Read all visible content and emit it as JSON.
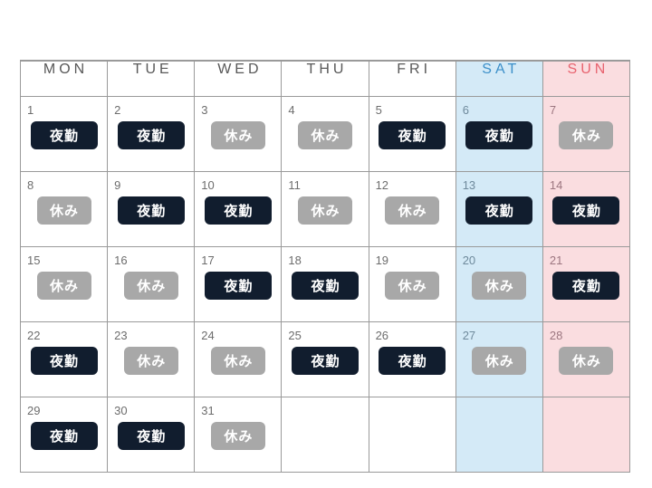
{
  "calendar": {
    "headers": [
      {
        "label": "MON",
        "kind": "weekday"
      },
      {
        "label": "TUE",
        "kind": "weekday"
      },
      {
        "label": "WED",
        "kind": "weekday"
      },
      {
        "label": "THU",
        "kind": "weekday"
      },
      {
        "label": "FRI",
        "kind": "weekday"
      },
      {
        "label": "SAT",
        "kind": "saturday"
      },
      {
        "label": "SUN",
        "kind": "sunday"
      }
    ],
    "shift_labels": {
      "night": "夜勤",
      "off": "休み"
    },
    "colors": {
      "night_badge": "#111d2e",
      "off_badge": "#a8a8a8",
      "badge_text": "#ffffff",
      "saturday_bg": "#d4eaf7",
      "saturday_text": "#3b8fc9",
      "sunday_bg": "#fadde0",
      "sunday_text": "#e8636f",
      "grid_line": "#9a9a9a",
      "day_number": "#6d6d6d",
      "header_text": "#585858",
      "page_bg": "#ffffff"
    },
    "weeks": [
      [
        {
          "day": "1",
          "shift": "night"
        },
        {
          "day": "2",
          "shift": "night"
        },
        {
          "day": "3",
          "shift": "off"
        },
        {
          "day": "4",
          "shift": "off"
        },
        {
          "day": "5",
          "shift": "night"
        },
        {
          "day": "6",
          "shift": "night"
        },
        {
          "day": "7",
          "shift": "off"
        }
      ],
      [
        {
          "day": "8",
          "shift": "off"
        },
        {
          "day": "9",
          "shift": "night"
        },
        {
          "day": "10",
          "shift": "night"
        },
        {
          "day": "11",
          "shift": "off"
        },
        {
          "day": "12",
          "shift": "off"
        },
        {
          "day": "13",
          "shift": "night"
        },
        {
          "day": "14",
          "shift": "night"
        }
      ],
      [
        {
          "day": "15",
          "shift": "off"
        },
        {
          "day": "16",
          "shift": "off"
        },
        {
          "day": "17",
          "shift": "night"
        },
        {
          "day": "18",
          "shift": "night"
        },
        {
          "day": "19",
          "shift": "off"
        },
        {
          "day": "20",
          "shift": "off"
        },
        {
          "day": "21",
          "shift": "night"
        }
      ],
      [
        {
          "day": "22",
          "shift": "night"
        },
        {
          "day": "23",
          "shift": "off"
        },
        {
          "day": "24",
          "shift": "off"
        },
        {
          "day": "25",
          "shift": "night"
        },
        {
          "day": "26",
          "shift": "night"
        },
        {
          "day": "27",
          "shift": "off"
        },
        {
          "day": "28",
          "shift": "off"
        }
      ],
      [
        {
          "day": "29",
          "shift": "night"
        },
        {
          "day": "30",
          "shift": "night"
        },
        {
          "day": "31",
          "shift": "off"
        },
        {
          "day": "",
          "shift": "none"
        },
        {
          "day": "",
          "shift": "none"
        },
        {
          "day": "",
          "shift": "none"
        },
        {
          "day": "",
          "shift": "none"
        }
      ]
    ]
  }
}
